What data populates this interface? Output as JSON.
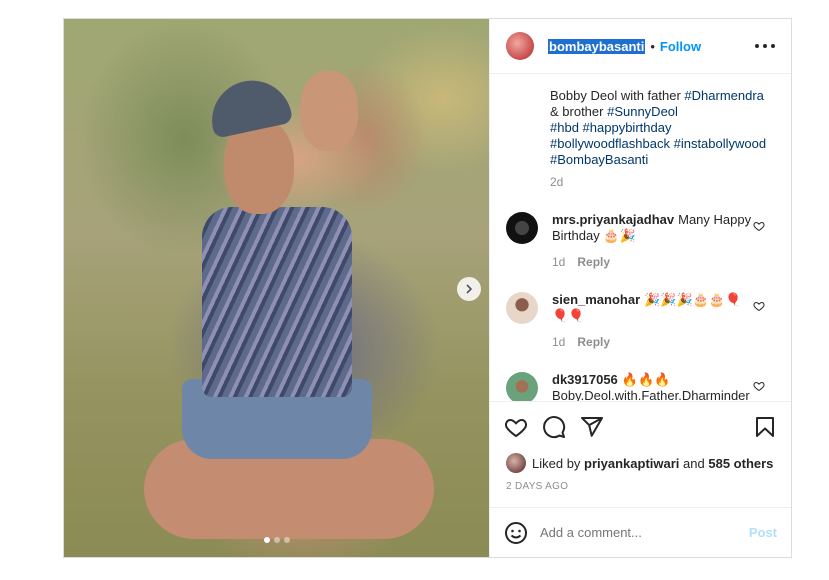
{
  "post": {
    "username": "bombaybasanti",
    "follow_label": "Follow",
    "separator": "•",
    "caption_plain": "Bobby Deol with father ",
    "caption_tags": [
      "#Dharmendra",
      "#SunnyDeol",
      "#hbd",
      "#happybirthday",
      "#bollywoodflashback",
      "#instabollywood",
      "#BombayBasanti"
    ],
    "caption_mid": " & brother ",
    "caption_age": "2d",
    "likes": {
      "prefix": "Liked by ",
      "user": "priyankaptiwari",
      "middle": " and ",
      "others": "585 others"
    },
    "date": "2 DAYS AGO",
    "comment_placeholder": "Add a comment...",
    "post_label": "Post"
  },
  "comments": [
    {
      "user": "mrs.priyankajadhav",
      "text": "Many Happy Birthday 🎂🎉",
      "age": "1d",
      "reply": "Reply",
      "avatar_color": "#222222"
    },
    {
      "user": "sien_manohar",
      "text": "🎉🎉🎉🎂🎂🎈🎈🎈",
      "age": "1d",
      "reply": "Reply",
      "avatar_color": "#d9c2b0"
    },
    {
      "user": "dk3917056",
      "text": "🔥🔥🔥 Boby.Deol.with.Father.Dharminder🔥🔥🔥",
      "age": "",
      "reply": "",
      "avatar_color": "#6aa37b"
    }
  ],
  "icons": [
    "heart-icon",
    "comment-icon",
    "share-icon",
    "bookmark-icon",
    "emoji-icon",
    "more-icon",
    "chevron-right-icon"
  ],
  "colors": {
    "link": "#0095f6",
    "hashtag": "#00376b",
    "muted": "#8e8e8e",
    "post_disabled": "#b2dffc"
  },
  "carousel": {
    "slides": 3,
    "active": 1
  }
}
